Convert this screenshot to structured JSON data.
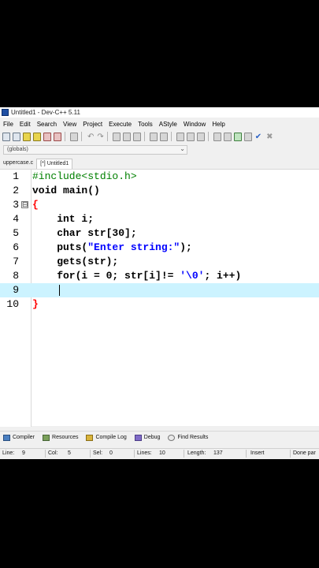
{
  "window": {
    "title": "Untitled1 - Dev-C++ 5.11"
  },
  "menu": [
    "File",
    "Edit",
    "Search",
    "View",
    "Project",
    "Execute",
    "Tools",
    "AStyle",
    "Window",
    "Help"
  ],
  "scope": {
    "selected": "(globals)"
  },
  "tabs": [
    {
      "label": "uppercase.c",
      "active": false
    },
    {
      "label": "[*] Untitled1",
      "active": true
    }
  ],
  "editor": {
    "lines": [
      {
        "num": "1",
        "text": "#include<stdio.h>",
        "style": "pp"
      },
      {
        "num": "2",
        "text": "void main()",
        "style": "plain"
      },
      {
        "num": "3",
        "text": "{",
        "style": "brace",
        "fold": "⊟"
      },
      {
        "num": "4",
        "text": "    int i;",
        "style": "plain"
      },
      {
        "num": "5",
        "text": "    char str[30];",
        "style": "plain"
      },
      {
        "num": "6",
        "text": "    puts(\"Enter string:\");",
        "style": "plain"
      },
      {
        "num": "7",
        "text": "    gets(str);",
        "style": "plain"
      },
      {
        "num": "8",
        "text": "    for(i = 0; str[i]!= '\\0'; i++)",
        "style": "plain"
      },
      {
        "num": "9",
        "text": "    ",
        "style": "plain",
        "current": true
      },
      {
        "num": "10",
        "text": "}",
        "style": "brace"
      }
    ]
  },
  "bottom_tabs": [
    {
      "label": "Compiler",
      "icon": "compiler-icon"
    },
    {
      "label": "Resources",
      "icon": "resources-icon"
    },
    {
      "label": "Compile Log",
      "icon": "compile-log-icon"
    },
    {
      "label": "Debug",
      "icon": "debug-icon"
    },
    {
      "label": "Find Results",
      "icon": "find-results-icon"
    }
  ],
  "status": {
    "line_label": "Line:",
    "line_value": "9",
    "col_label": "Col:",
    "col_value": "5",
    "sel_label": "Sel:",
    "sel_value": "0",
    "lines_label": "Lines:",
    "lines_value": "10",
    "length_label": "Length:",
    "length_value": "137",
    "mode": "Insert",
    "message": "Done par"
  },
  "colors": {
    "current_line": "#ccf3ff",
    "preprocessor": "#008000",
    "string": "#0000ff",
    "brace": "#ff0000"
  }
}
